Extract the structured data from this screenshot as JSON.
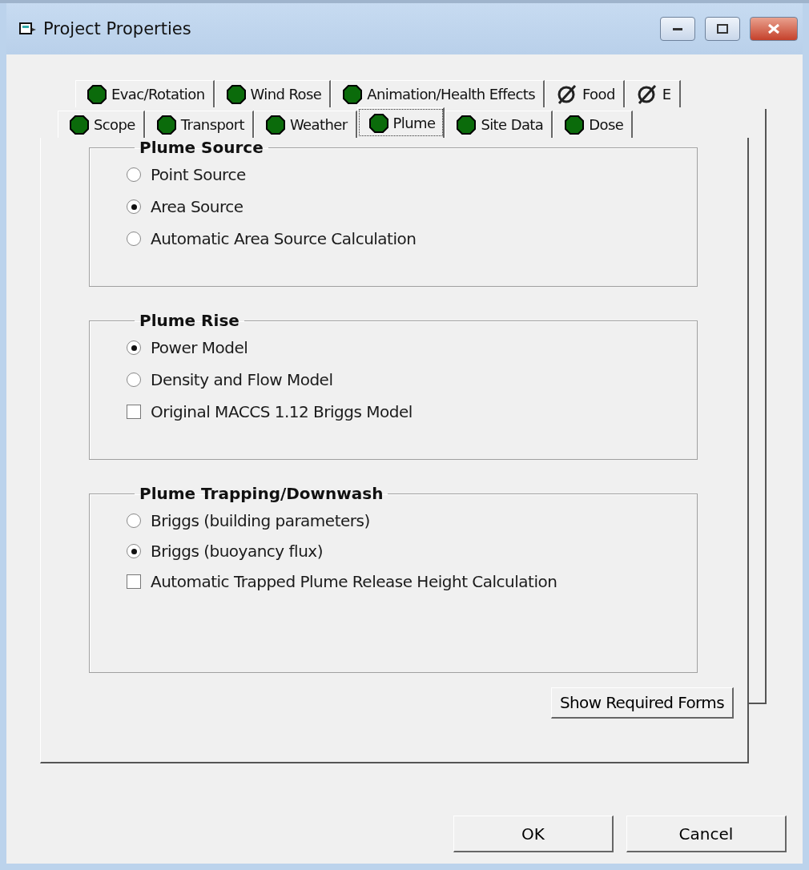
{
  "window": {
    "title": "Project Properties"
  },
  "tab_rows": [
    [
      {
        "label": "Evac/Rotation",
        "kind": "ok",
        "selected": false
      },
      {
        "label": "Wind Rose",
        "kind": "ok",
        "selected": false
      },
      {
        "label": "Animation/Health Effects",
        "kind": "ok",
        "selected": false
      },
      {
        "label": "Food",
        "kind": "none",
        "selected": false
      },
      {
        "label": "E",
        "kind": "none",
        "selected": false
      }
    ],
    [
      {
        "label": "Scope",
        "kind": "ok",
        "selected": false
      },
      {
        "label": "Transport",
        "kind": "ok",
        "selected": false
      },
      {
        "label": "Weather",
        "kind": "ok",
        "selected": false
      },
      {
        "label": "Plume",
        "kind": "ok",
        "selected": true
      },
      {
        "label": "Site Data",
        "kind": "ok",
        "selected": false
      },
      {
        "label": "Dose",
        "kind": "ok",
        "selected": false
      }
    ]
  ],
  "groups": [
    {
      "title": "Plume Source",
      "options": [
        {
          "label": "Point Source",
          "kind": "radio",
          "checked": false
        },
        {
          "label": "Area Source",
          "kind": "radio",
          "checked": true
        },
        {
          "label": "Automatic Area Source Calculation",
          "kind": "radio",
          "checked": false
        }
      ]
    },
    {
      "title": "Plume Rise",
      "options": [
        {
          "label": "Power Model",
          "kind": "radio",
          "checked": true
        },
        {
          "label": "Density and Flow Model",
          "kind": "radio",
          "checked": false
        },
        {
          "label": "Original MACCS 1.12 Briggs Model",
          "kind": "checkbox",
          "checked": false
        }
      ]
    },
    {
      "title": "Plume Trapping/Downwash",
      "options": [
        {
          "label": "Briggs (building parameters)",
          "kind": "radio",
          "checked": false
        },
        {
          "label": "Briggs (buoyancy flux)",
          "kind": "radio",
          "checked": true
        },
        {
          "label": "Automatic Trapped Plume Release Height Calculation",
          "kind": "checkbox",
          "checked": false
        }
      ]
    }
  ],
  "panel_button": "Show Required Forms",
  "buttons": [
    "OK",
    "Cancel"
  ]
}
